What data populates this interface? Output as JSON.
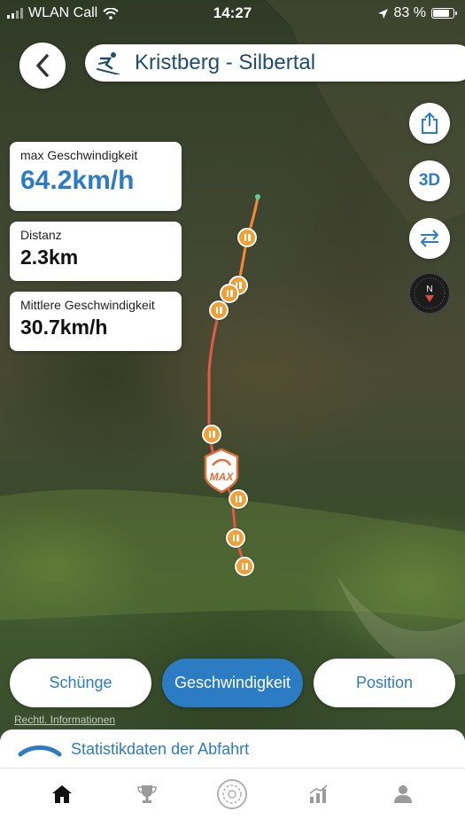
{
  "status_bar": {
    "carrier": "WLAN Call",
    "time": "14:27",
    "battery": "83 %"
  },
  "header": {
    "title": "Kristberg - Silbertal",
    "back_icon": "chevron-left-icon",
    "sport_icon": "skier-icon"
  },
  "side_buttons": {
    "share_icon": "share-icon",
    "mode_label": "3D",
    "swap_icon": "swap-arrows-icon",
    "compass_label": "N"
  },
  "stats": [
    {
      "label": "max Geschwindigkeit",
      "value": "64.2km/h"
    },
    {
      "label": "Distanz",
      "value": "2.3km"
    },
    {
      "label": "Mittlere Geschwindigkeit",
      "value": "30.7km/h"
    }
  ],
  "map": {
    "max_marker_label": "MAX",
    "legal_link": "Rechtl. Informationen",
    "route_color": "#e05a4e",
    "pin_color": "#f0a035"
  },
  "segments": [
    {
      "label": "Schünge",
      "active": false
    },
    {
      "label": "Geschwindigkeit",
      "active": true
    },
    {
      "label": "Position",
      "active": false
    }
  ],
  "sheet": {
    "label": "Statistikdaten der Abfahrt"
  },
  "tabs": [
    {
      "icon": "home-icon",
      "active": true
    },
    {
      "icon": "trophy-icon",
      "active": false
    },
    {
      "icon": "snowflake-icon",
      "active": false
    },
    {
      "icon": "stats-icon",
      "active": false
    },
    {
      "icon": "profile-icon",
      "active": false
    }
  ],
  "colors": {
    "accent": "#2c7cc4",
    "title": "#1f4e6e"
  }
}
